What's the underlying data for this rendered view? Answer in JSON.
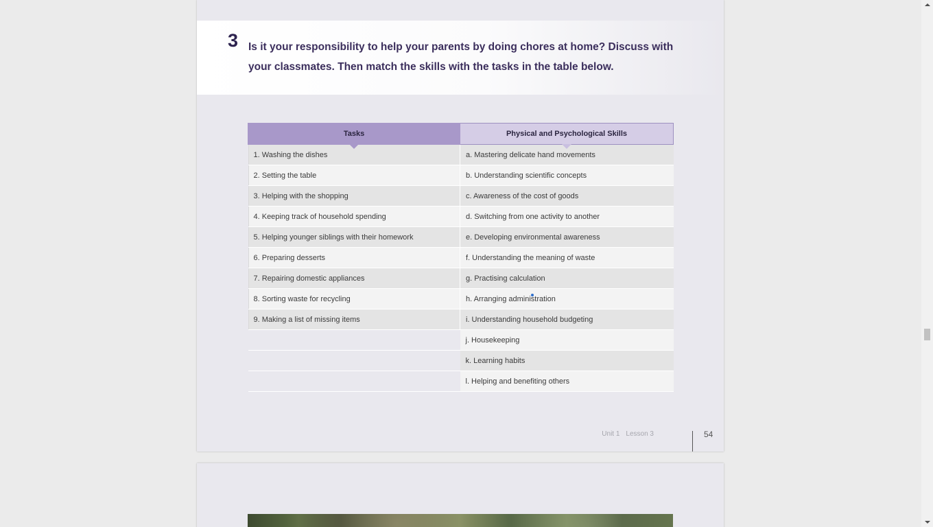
{
  "exercise": {
    "number": "3",
    "instruction": "Is it your responsibility to help your parents by doing chores at home? Discuss with your classmates. Then match the skills with the tasks in the table below."
  },
  "table": {
    "headers": {
      "tasks": "Tasks",
      "skills": "Physical and Psychological Skills"
    },
    "tasks": [
      "1. Washing the dishes",
      "2. Setting the table",
      "3. Helping with the shopping",
      "4. Keeping track of household spending",
      "5. Helping younger siblings with their homework",
      "6. Preparing desserts",
      "7. Repairing domestic appliances",
      "8. Sorting waste for recycling",
      "9. Making a list of missing items"
    ],
    "skills": [
      "a. Mastering delicate hand movements",
      "b. Understanding scientific concepts",
      "c. Awareness of the cost of goods",
      "d. Switching from one activity to another",
      "e. Developing environmental awareness",
      "f. Understanding the meaning of waste",
      "g. Practising calculation",
      "h. Arranging administration",
      "i. Understanding household budgeting",
      "j. Housekeeping",
      "k. Learning habits",
      "l. Helping and benefiting others"
    ]
  },
  "footer": {
    "unit": "Unit 1",
    "lesson": "Lesson 3",
    "page_number": "54"
  },
  "colors": {
    "tasks_header": "#a898c9",
    "skills_header": "#d5cde6",
    "title_text": "#3b2e5c"
  },
  "icons": {
    "scroll_up": "triangle-up-icon",
    "scroll_down": "triangle-down-icon"
  }
}
